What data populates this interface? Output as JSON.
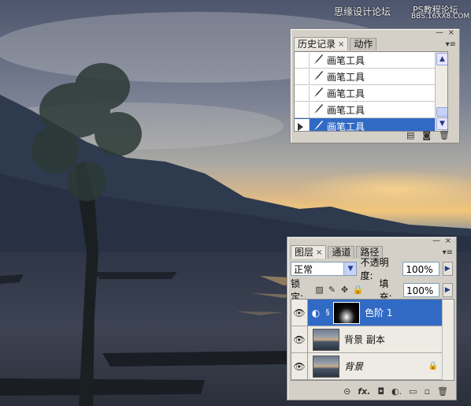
{
  "watermark": {
    "line1": "思缘设计论坛",
    "line2": "PS教程论坛",
    "line3": "BBS.16XX8.COM"
  },
  "history_panel": {
    "tabs": [
      {
        "label": "历史记录",
        "close": "×"
      },
      {
        "label": "动作"
      }
    ],
    "window_buttons": {
      "minimize": "—",
      "close": "×"
    },
    "menu_icon": "▾≡",
    "items": [
      {
        "label": "画笔工具",
        "selected": false
      },
      {
        "label": "画笔工具",
        "selected": false
      },
      {
        "label": "画笔工具",
        "selected": false
      },
      {
        "label": "画笔工具",
        "selected": false
      },
      {
        "label": "画笔工具",
        "selected": true
      }
    ],
    "bottom_icons": [
      "new-document-from-state-icon",
      "snapshot-icon",
      "trash-icon"
    ]
  },
  "layers_panel": {
    "tabs": [
      {
        "label": "图层",
        "close": "×"
      },
      {
        "label": "通道"
      },
      {
        "label": "路径"
      }
    ],
    "window_buttons": {
      "minimize": "—",
      "close": "×"
    },
    "menu_icon": "▾≡",
    "blend_mode": "正常",
    "opacity_label": "不透明度:",
    "opacity_value": "100%",
    "lock_label": "锁定:",
    "fill_label": "填充:",
    "fill_value": "100%",
    "layers": [
      {
        "name": "色阶 1",
        "selected": true,
        "type": "adjustment"
      },
      {
        "name": "背景 副本",
        "selected": false,
        "type": "image"
      },
      {
        "name": "背景",
        "selected": false,
        "type": "background",
        "locked": true
      }
    ],
    "bottom_icons": {
      "link": "⊝",
      "fx": "fx.",
      "mask": "◘",
      "adjust": "◐.",
      "group": "▭",
      "new": "▫",
      "delete": "🗑"
    }
  }
}
